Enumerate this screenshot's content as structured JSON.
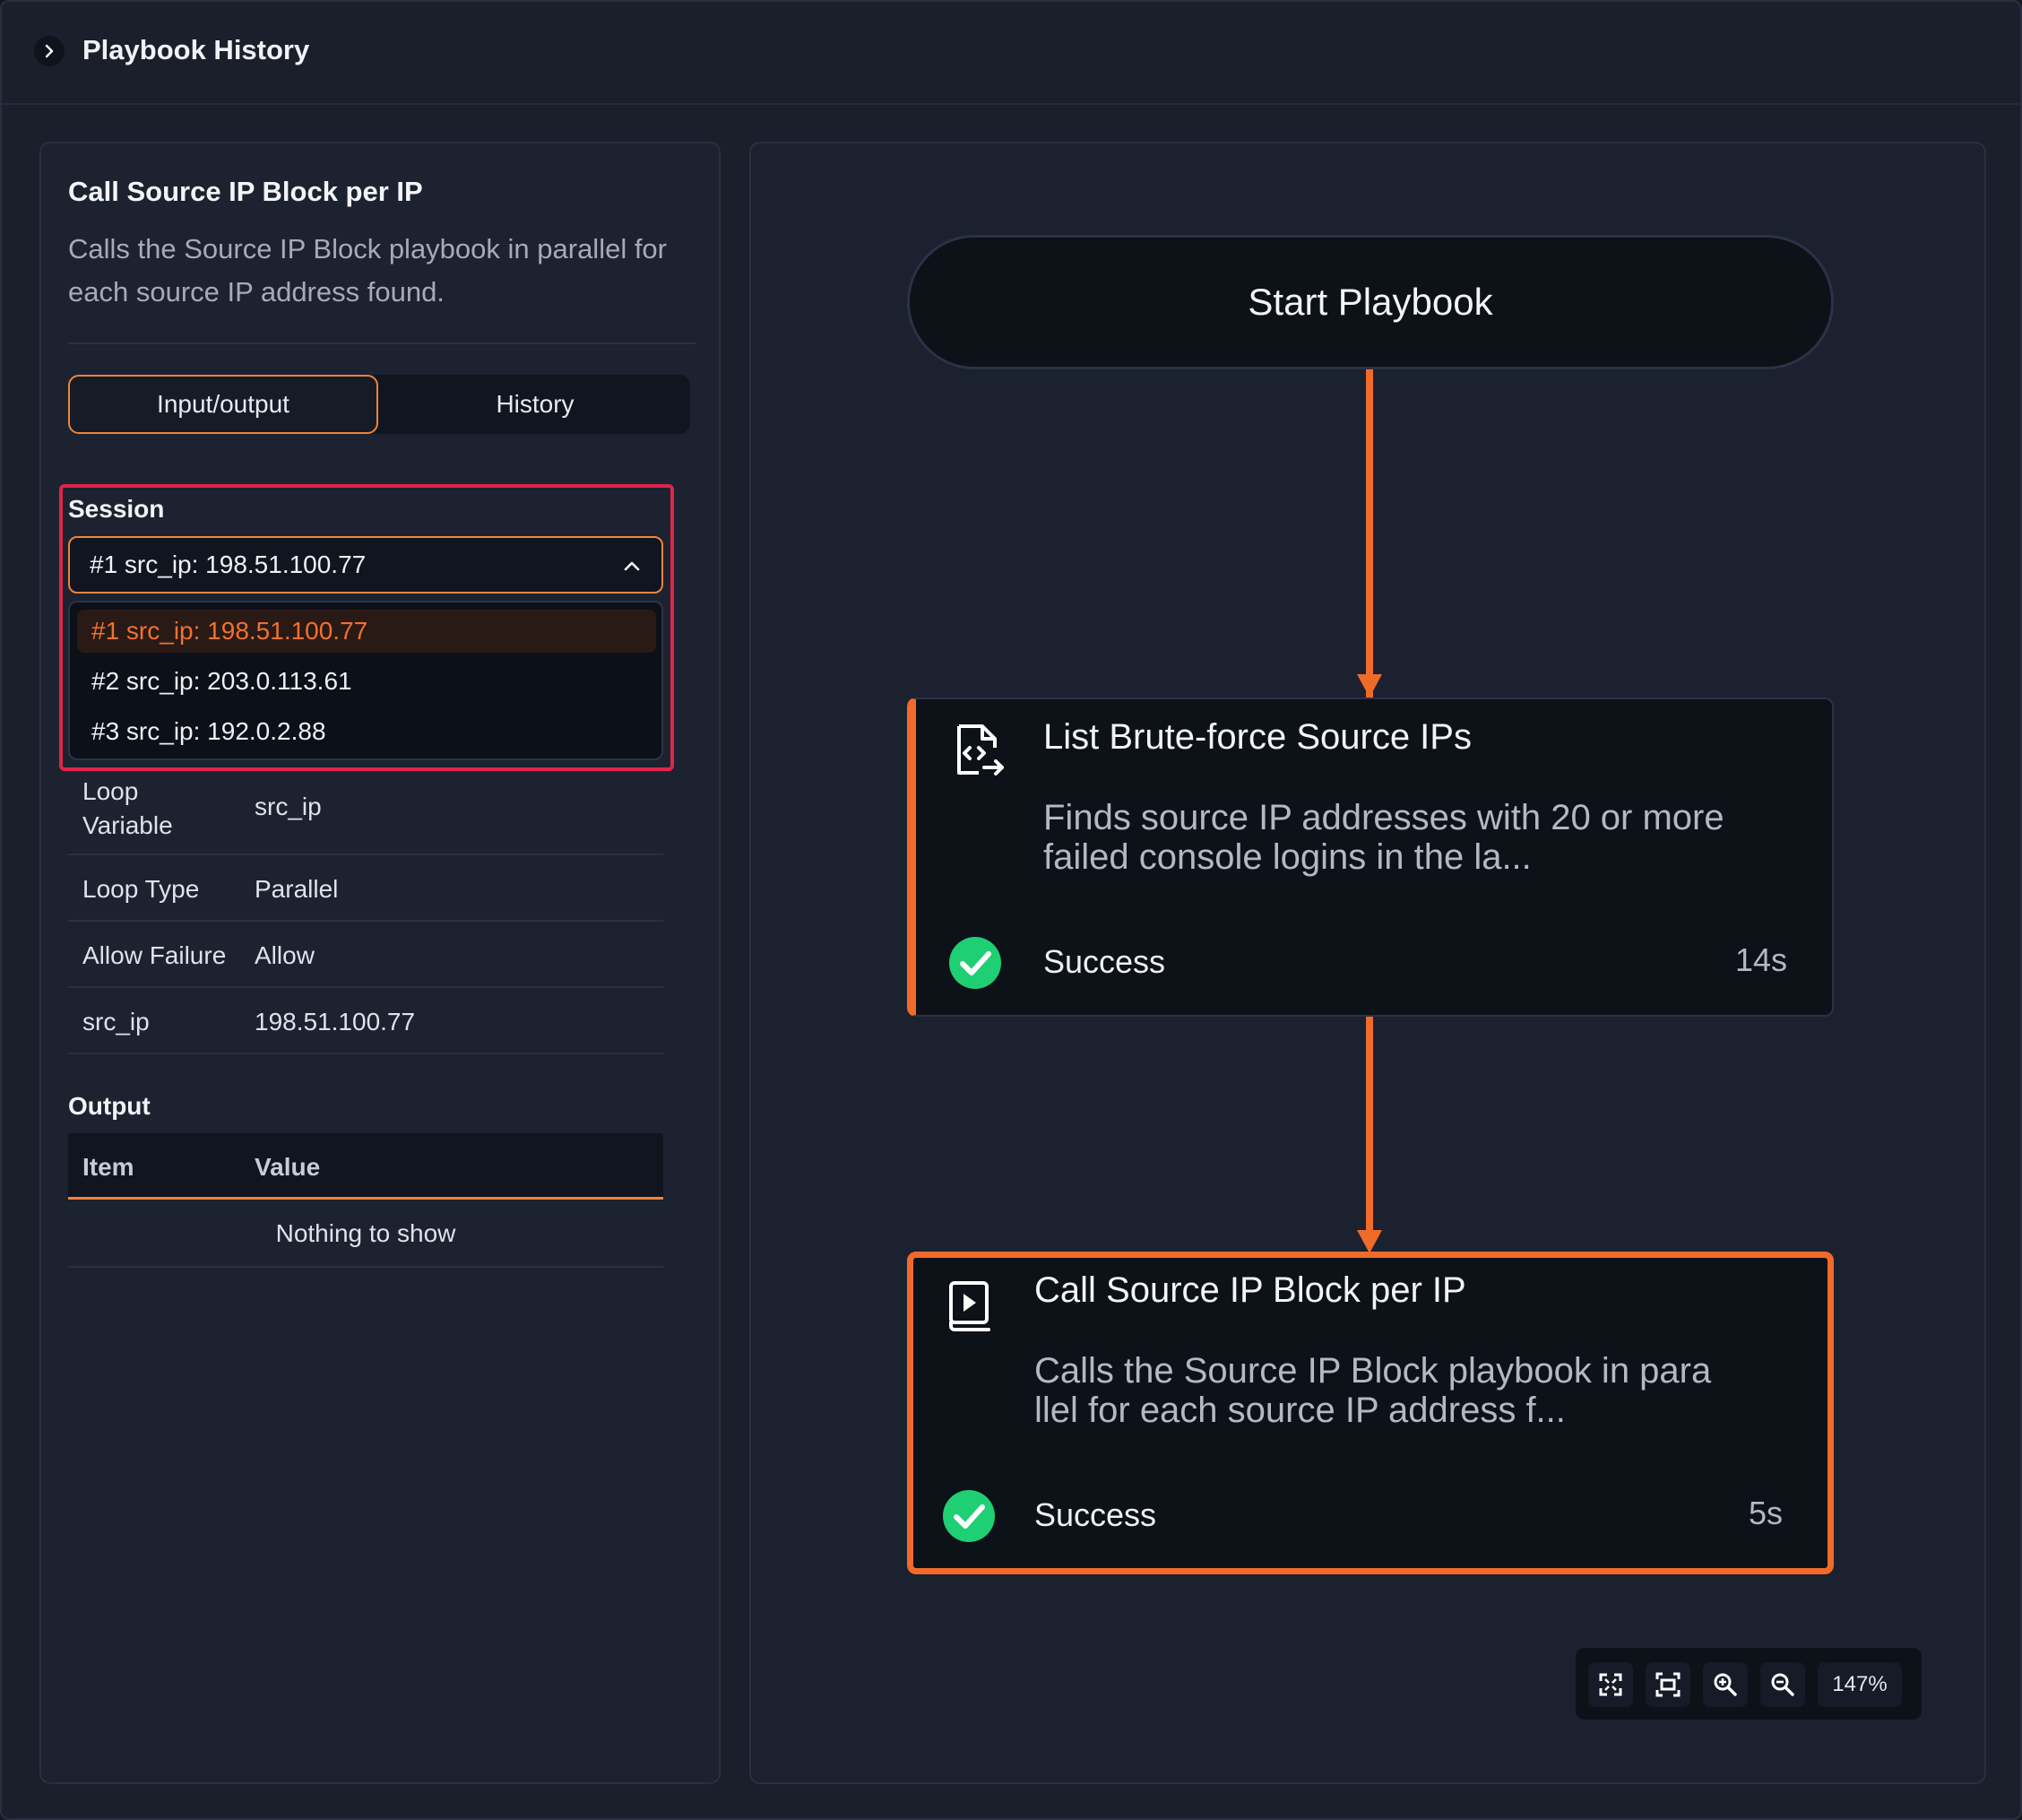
{
  "header": {
    "title": "Playbook History"
  },
  "step": {
    "title": "Call Source IP Block per IP",
    "description": "Calls the Source IP Block playbook in parallel for each source IP address found."
  },
  "tabs": [
    {
      "label": "Input/output",
      "active": true
    },
    {
      "label": "History",
      "active": false
    }
  ],
  "session": {
    "label": "Session",
    "selected": "#1 src_ip: 198.51.100.77",
    "options": [
      "#1 src_ip: 198.51.100.77",
      "#2 src_ip: 203.0.113.61",
      "#3 src_ip: 192.0.2.88"
    ]
  },
  "properties": [
    {
      "key": "Loop Variable",
      "value": "src_ip"
    },
    {
      "key": "Loop Type",
      "value": "Parallel"
    },
    {
      "key": "Allow Failure",
      "value": "Allow"
    },
    {
      "key": "src_ip",
      "value": "198.51.100.77"
    }
  ],
  "output": {
    "label": "Output",
    "columns": [
      "Item",
      "Value"
    ],
    "empty_text": "Nothing to show"
  },
  "flow": {
    "start_label": "Start Playbook",
    "nodes": [
      {
        "title": "List Brute-force Source IPs",
        "description": "Finds source IP addresses with 20 or more failed console logins in the la...",
        "status": "Success",
        "duration": "14s"
      },
      {
        "title": "Call Source IP Block per IP",
        "description": "Calls the Source IP Block playbook in parallel for each source IP address f...",
        "status": "Success",
        "duration": "5s"
      }
    ]
  },
  "zoom": {
    "level": "147%"
  },
  "colors": {
    "accent": "#f06a2a",
    "highlight": "#e0244a",
    "success": "#1fcf73"
  }
}
